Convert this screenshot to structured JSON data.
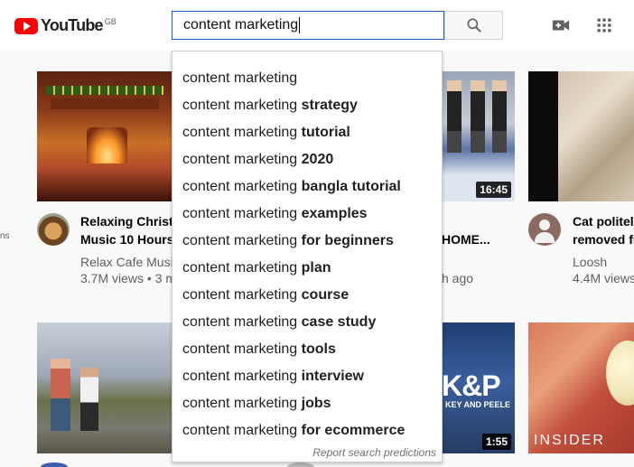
{
  "header": {
    "logo_text": "YouTube",
    "region": "GB",
    "search_value": "content marketing",
    "search_button_icon": "search-icon",
    "create_icon": "video-camera-plus-icon",
    "apps_icon": "apps-grid-icon"
  },
  "left_edge_text": "ns",
  "suggestions": {
    "base": "content marketing",
    "items": [
      {
        "completion": ""
      },
      {
        "completion": "strategy"
      },
      {
        "completion": "tutorial"
      },
      {
        "completion": "2020"
      },
      {
        "completion": "bangla tutorial"
      },
      {
        "completion": "examples"
      },
      {
        "completion": "for beginners"
      },
      {
        "completion": "plan"
      },
      {
        "completion": "course"
      },
      {
        "completion": "case study"
      },
      {
        "completion": "tools"
      },
      {
        "completion": "interview"
      },
      {
        "completion": "jobs"
      },
      {
        "completion": "for ecommerce"
      }
    ],
    "report_link": "Report search predictions"
  },
  "videos": {
    "v1": {
      "title_line1": "Relaxing Christm",
      "title_line2": "Music 10 Hours",
      "channel": "Relax Cafe Musi",
      "meta": "3.7M views • 3 m"
    },
    "v2": {
      "duration": "16:45",
      "title_line2": "HOME...",
      "meta": "h ago"
    },
    "v3": {
      "title_line1": "Cat politely",
      "title_line2": "removed fr",
      "channel": "Loosh",
      "meta": "4.4M views"
    },
    "v5": {
      "duration": "1:55",
      "brand": "K&P",
      "brand_sub": "KEY AND PEELE"
    },
    "v6": {
      "brand": "INSIDER"
    }
  }
}
